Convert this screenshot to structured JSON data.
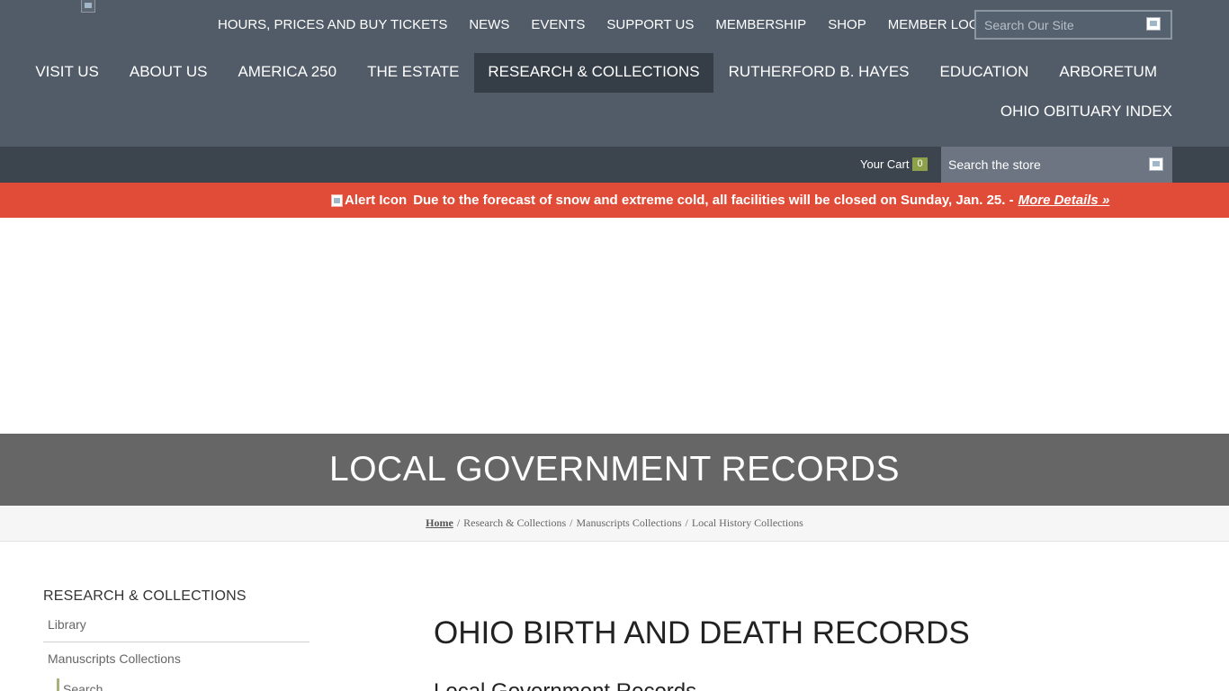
{
  "header": {
    "logo_alt": "",
    "util_nav": [
      {
        "label": "HOURS, PRICES AND BUY TICKETS"
      },
      {
        "label": "NEWS"
      },
      {
        "label": "EVENTS"
      },
      {
        "label": "SUPPORT US"
      },
      {
        "label": "MEMBERSHIP"
      },
      {
        "label": "SHOP"
      },
      {
        "label": "MEMBER LOGIN"
      }
    ],
    "search": {
      "placeholder": "Search Our Site"
    },
    "main_nav": [
      {
        "label": "VISIT US"
      },
      {
        "label": "ABOUT US"
      },
      {
        "label": "AMERICA 250"
      },
      {
        "label": "THE ESTATE"
      },
      {
        "label": "RESEARCH & COLLECTIONS",
        "active": true
      },
      {
        "label": "RUTHERFORD B. HAYES"
      },
      {
        "label": "EDUCATION"
      },
      {
        "label": "ARBORETUM"
      },
      {
        "label": "OHIO OBITUARY INDEX"
      }
    ]
  },
  "store_bar": {
    "cart_label": "Your Cart",
    "cart_count": "0",
    "search_placeholder": "Search the store"
  },
  "alert": {
    "icon_alt": "Alert Icon",
    "message": "Due to the forecast of snow and extreme cold, all facilities will be closed on Sunday, Jan. 25. -",
    "link_text": "More Details »"
  },
  "page": {
    "title": "LOCAL GOVERNMENT RECORDS",
    "breadcrumb": {
      "home": "Home",
      "items": [
        "Research & Collections",
        "Manuscripts Collections",
        "Local History Collections"
      ]
    }
  },
  "sidebar": {
    "heading": "RESEARCH & COLLECTIONS",
    "items": [
      {
        "label": "Library"
      },
      {
        "label": "Manuscripts Collections"
      }
    ],
    "sub_label": "Search"
  },
  "content": {
    "title": "OHIO BIRTH AND DEATH RECORDS",
    "subtitle": "Local Government Records"
  },
  "colors": {
    "header_bg": "#525c68",
    "store_bar_bg": "#3c444e",
    "alert_bg": "#e04c38",
    "title_bar_bg": "#666666",
    "active_nav_bg": "#353d47",
    "cart_badge": "#8ea14a"
  }
}
